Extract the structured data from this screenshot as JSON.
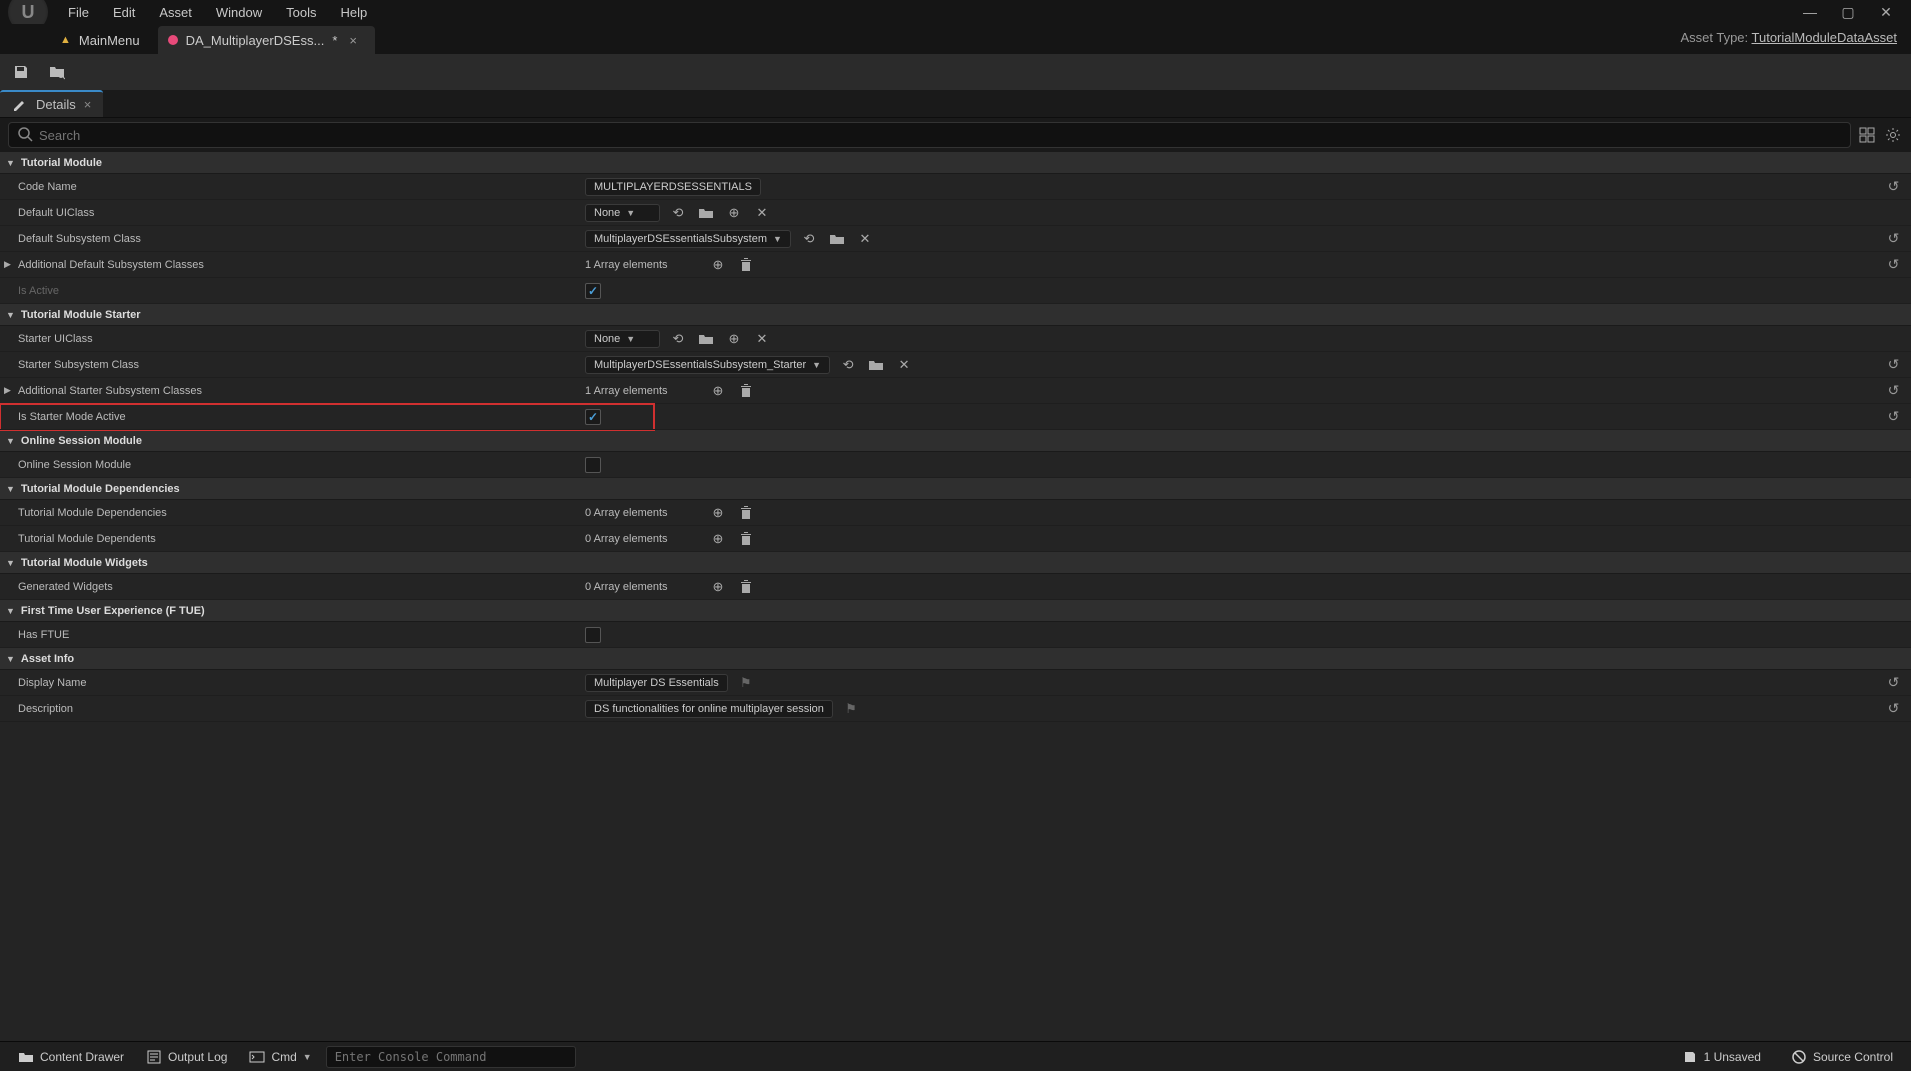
{
  "menubar": [
    "File",
    "Edit",
    "Asset",
    "Window",
    "Tools",
    "Help"
  ],
  "tabs": {
    "main_menu": "MainMenu",
    "asset_tab": "DA_MultiplayerDSEss...",
    "asset_dirty": "*"
  },
  "asset_type_prefix": "Asset Type: ",
  "asset_type": "TutorialModuleDataAsset",
  "details_tab": "Details",
  "search_placeholder": "Search",
  "categories": {
    "tutorial_module": "Tutorial Module",
    "tutorial_module_starter": "Tutorial Module Starter",
    "online_session_module": "Online Session Module",
    "tutorial_module_dependencies": "Tutorial Module Dependencies",
    "tutorial_module_widgets": "Tutorial Module Widgets",
    "ftue": "First Time User Experience (F TUE)",
    "asset_info": "Asset Info"
  },
  "props": {
    "code_name": {
      "label": "Code Name",
      "value": "MULTIPLAYERDSESSENTIALS"
    },
    "default_uiclass": {
      "label": "Default UIClass",
      "value": "None"
    },
    "default_subsystem_class": {
      "label": "Default Subsystem Class",
      "value": "MultiplayerDSEssentialsSubsystem"
    },
    "additional_default_subsystem": {
      "label": "Additional Default Subsystem Classes",
      "value": "1 Array elements"
    },
    "is_active": {
      "label": "Is Active"
    },
    "starter_uiclass": {
      "label": "Starter UIClass",
      "value": "None"
    },
    "starter_subsystem_class": {
      "label": "Starter Subsystem Class",
      "value": "MultiplayerDSEssentialsSubsystem_Starter"
    },
    "additional_starter_subsystem": {
      "label": "Additional Starter Subsystem Classes",
      "value": "1 Array elements"
    },
    "is_starter_mode_active": {
      "label": "Is Starter Mode Active"
    },
    "online_session_module": {
      "label": "Online Session Module"
    },
    "tutorial_module_dependencies": {
      "label": "Tutorial Module Dependencies",
      "value": "0 Array elements"
    },
    "tutorial_module_dependents": {
      "label": "Tutorial Module Dependents",
      "value": "0 Array elements"
    },
    "generated_widgets": {
      "label": "Generated Widgets",
      "value": "0 Array elements"
    },
    "has_ftue": {
      "label": "Has FTUE"
    },
    "display_name": {
      "label": "Display Name",
      "value": "Multiplayer DS Essentials"
    },
    "description": {
      "label": "Description",
      "value": "DS functionalities for online multiplayer session"
    }
  },
  "bottombar": {
    "content_drawer": "Content Drawer",
    "output_log": "Output Log",
    "cmd": "Cmd",
    "cmd_placeholder": "Enter Console Command",
    "unsaved": "1 Unsaved",
    "source_control": "Source Control"
  }
}
